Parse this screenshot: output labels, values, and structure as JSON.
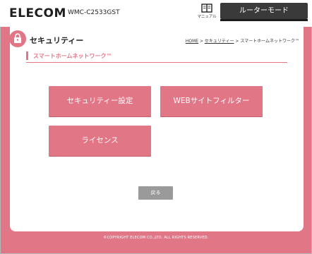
{
  "header": {
    "logo": "ELECOM",
    "model": "WMC-C2533GST",
    "manual_label": "マニュアル",
    "mode_label": "ルーターモード"
  },
  "page": {
    "title": "セキュリティー",
    "breadcrumb": {
      "home": "HOME",
      "sep1": " > ",
      "security": "セキュリティー",
      "sep2": " > ",
      "current": "スマートホームネットワーク™"
    }
  },
  "section": {
    "heading": "スマートホームネットワーク™"
  },
  "menu": {
    "security_settings": "セキュリティー設定",
    "web_filter": "WEBサイトフィルター",
    "license": "ライセンス"
  },
  "back_label": "戻る",
  "footer": "©COPYRIGHT ELECOM CO.,LTD. ALL RIGHTS RESERVED.",
  "colors": {
    "accent": "#e07686",
    "dark": "#3a3a3a",
    "back_button": "#9a9a9a"
  }
}
